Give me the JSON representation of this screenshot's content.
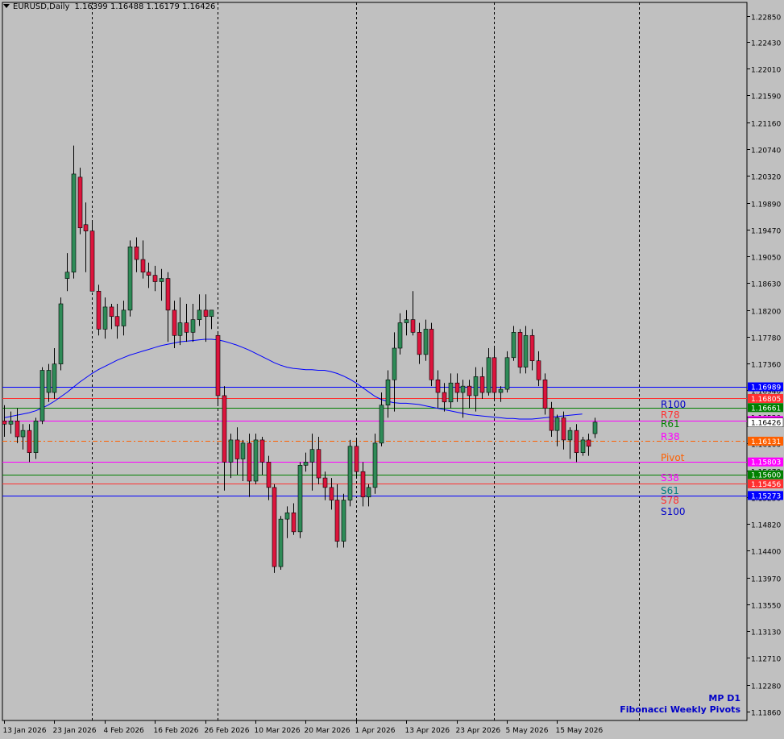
{
  "header": {
    "symbol": "EURUSD,Daily",
    "ohlc": "1.16399 1.16488 1.16179 1.16426"
  },
  "footer": {
    "line1": "MP D1",
    "line2": "Fibonacci Weekly Pivots"
  },
  "colors": {
    "background": "#c0c0c0",
    "bull": "#2e8b57",
    "bear": "#dc143c",
    "ma": "#0000ff",
    "grid": "#000000"
  },
  "chart_data": {
    "type": "candlestick",
    "symbol": "EURUSD",
    "timeframe": "Daily",
    "ylim": [
      1.1172,
      1.2306
    ],
    "y_ticks": [
      "1.22850",
      "1.22430",
      "1.22010",
      "1.21590",
      "1.21160",
      "1.20740",
      "1.20320",
      "1.19890",
      "1.19470",
      "1.19050",
      "1.18630",
      "1.18200",
      "1.17780",
      "1.17360",
      "1.16940",
      "1.16520",
      "1.16100",
      "1.15670",
      "1.15250",
      "1.14820",
      "1.14400",
      "1.13970",
      "1.13550",
      "1.13130",
      "1.12710",
      "1.12280",
      "1.11860"
    ],
    "x_ticks": [
      "13 Jan 2026",
      "23 Jan 2026",
      "4 Feb 2026",
      "16 Feb 2026",
      "26 Feb 2026",
      "10 Mar 2026",
      "20 Mar 2026",
      "1 Apr 2026",
      "13 Apr 2026",
      "23 Apr 2026",
      "5 May 2026",
      "15 May 2026"
    ],
    "x_tick_index": [
      0,
      8,
      16,
      24,
      32,
      40,
      48,
      56,
      64,
      72,
      80,
      88
    ],
    "separator_index": [
      14,
      34,
      56,
      78,
      101
    ],
    "candles": [
      [
        1.1645,
        1.167,
        1.162,
        1.164
      ],
      [
        1.164,
        1.166,
        1.1625,
        1.1645
      ],
      [
        1.1645,
        1.1665,
        1.161,
        1.162
      ],
      [
        1.162,
        1.164,
        1.16,
        1.163
      ],
      [
        1.163,
        1.164,
        1.158,
        1.1595
      ],
      [
        1.1595,
        1.165,
        1.1585,
        1.1645
      ],
      [
        1.1645,
        1.173,
        1.164,
        1.1725
      ],
      [
        1.169,
        1.1735,
        1.1675,
        1.1725
      ],
      [
        1.169,
        1.176,
        1.168,
        1.1735
      ],
      [
        1.1735,
        1.184,
        1.1725,
        1.183
      ],
      [
        1.187,
        1.191,
        1.185,
        1.188
      ],
      [
        1.188,
        1.208,
        1.187,
        1.2035
      ],
      [
        1.203,
        1.2045,
        1.194,
        1.195
      ],
      [
        1.1955,
        1.199,
        1.188,
        1.1945
      ],
      [
        1.1945,
        1.196,
        1.1855,
        1.185
      ],
      [
        1.185,
        1.186,
        1.178,
        1.179
      ],
      [
        1.179,
        1.184,
        1.1775,
        1.1825
      ],
      [
        1.1825,
        1.183,
        1.179,
        1.181
      ],
      [
        1.181,
        1.183,
        1.1775,
        1.1795
      ],
      [
        1.1795,
        1.1835,
        1.178,
        1.182
      ],
      [
        1.182,
        1.193,
        1.181,
        1.192
      ],
      [
        1.192,
        1.1935,
        1.188,
        1.19
      ],
      [
        1.19,
        1.193,
        1.187,
        1.188
      ],
      [
        1.188,
        1.1895,
        1.1855,
        1.1875
      ],
      [
        1.1875,
        1.189,
        1.185,
        1.1865
      ],
      [
        1.1865,
        1.1885,
        1.1835,
        1.187
      ],
      [
        1.187,
        1.188,
        1.177,
        1.182
      ],
      [
        1.182,
        1.1835,
        1.176,
        1.178
      ],
      [
        1.178,
        1.184,
        1.1765,
        1.18
      ],
      [
        1.18,
        1.183,
        1.177,
        1.1785
      ],
      [
        1.1785,
        1.183,
        1.177,
        1.1805
      ],
      [
        1.1805,
        1.1845,
        1.1795,
        1.182
      ],
      [
        1.182,
        1.1845,
        1.177,
        1.181
      ],
      [
        1.181,
        1.182,
        1.179,
        1.182
      ],
      [
        1.178,
        1.1785,
        1.167,
        1.1685
      ],
      [
        1.1685,
        1.17,
        1.1535,
        1.158
      ],
      [
        1.158,
        1.1625,
        1.1555,
        1.1615
      ],
      [
        1.1615,
        1.1635,
        1.156,
        1.1585
      ],
      [
        1.1585,
        1.1615,
        1.155,
        1.161
      ],
      [
        1.161,
        1.1625,
        1.1525,
        1.155
      ],
      [
        1.155,
        1.1625,
        1.1545,
        1.1615
      ],
      [
        1.1615,
        1.162,
        1.156,
        1.158
      ],
      [
        1.158,
        1.159,
        1.152,
        1.154
      ],
      [
        1.154,
        1.1545,
        1.1405,
        1.1415
      ],
      [
        1.1415,
        1.1495,
        1.141,
        1.149
      ],
      [
        1.149,
        1.151,
        1.146,
        1.15
      ],
      [
        1.15,
        1.1515,
        1.1465,
        1.147
      ],
      [
        1.147,
        1.158,
        1.146,
        1.1575
      ],
      [
        1.1575,
        1.1595,
        1.1565,
        1.158
      ],
      [
        1.158,
        1.1625,
        1.1535,
        1.16
      ],
      [
        1.16,
        1.162,
        1.1545,
        1.1555
      ],
      [
        1.1555,
        1.1565,
        1.152,
        1.154
      ],
      [
        1.154,
        1.1555,
        1.1505,
        1.152
      ],
      [
        1.152,
        1.1545,
        1.1445,
        1.1455
      ],
      [
        1.1455,
        1.153,
        1.1445,
        1.152
      ],
      [
        1.152,
        1.1615,
        1.151,
        1.1605
      ],
      [
        1.1605,
        1.1615,
        1.1555,
        1.1565
      ],
      [
        1.1565,
        1.158,
        1.151,
        1.1525
      ],
      [
        1.1525,
        1.1545,
        1.151,
        1.154
      ],
      [
        1.154,
        1.1625,
        1.153,
        1.161
      ],
      [
        1.161,
        1.169,
        1.1605,
        1.167
      ],
      [
        1.167,
        1.1725,
        1.165,
        1.171
      ],
      [
        1.171,
        1.1785,
        1.166,
        1.176
      ],
      [
        1.176,
        1.1815,
        1.175,
        1.18
      ],
      [
        1.18,
        1.182,
        1.178,
        1.1805
      ],
      [
        1.1805,
        1.185,
        1.178,
        1.1785
      ],
      [
        1.1785,
        1.18,
        1.1735,
        1.175
      ],
      [
        1.175,
        1.1805,
        1.174,
        1.179
      ],
      [
        1.179,
        1.18,
        1.17,
        1.171
      ],
      [
        1.171,
        1.1725,
        1.1665,
        1.169
      ],
      [
        1.169,
        1.1705,
        1.166,
        1.1675
      ],
      [
        1.1675,
        1.172,
        1.1665,
        1.1705
      ],
      [
        1.1705,
        1.172,
        1.1675,
        1.169
      ],
      [
        1.169,
        1.171,
        1.165,
        1.17
      ],
      [
        1.17,
        1.171,
        1.1665,
        1.1685
      ],
      [
        1.1685,
        1.173,
        1.166,
        1.1715
      ],
      [
        1.1715,
        1.173,
        1.168,
        1.169
      ],
      [
        1.169,
        1.176,
        1.1685,
        1.1745
      ],
      [
        1.1745,
        1.176,
        1.168,
        1.169
      ],
      [
        1.169,
        1.17,
        1.1675,
        1.1695
      ],
      [
        1.1695,
        1.1755,
        1.169,
        1.1745
      ],
      [
        1.1745,
        1.1795,
        1.174,
        1.1785
      ],
      [
        1.1785,
        1.179,
        1.172,
        1.173
      ],
      [
        1.173,
        1.1795,
        1.172,
        1.178
      ],
      [
        1.178,
        1.179,
        1.1725,
        1.174
      ],
      [
        1.174,
        1.1755,
        1.17,
        1.171
      ],
      [
        1.171,
        1.172,
        1.1655,
        1.1665
      ],
      [
        1.1665,
        1.1675,
        1.162,
        1.163
      ],
      [
        1.163,
        1.1655,
        1.1605,
        1.165
      ],
      [
        1.165,
        1.166,
        1.16,
        1.1615
      ],
      [
        1.1615,
        1.1635,
        1.1585,
        1.163
      ],
      [
        1.163,
        1.164,
        1.158,
        1.1595
      ],
      [
        1.1595,
        1.162,
        1.159,
        1.1615
      ],
      [
        1.1615,
        1.1625,
        1.159,
        1.1605
      ],
      [
        1.1625,
        1.165,
        1.1618,
        1.1643
      ]
    ],
    "ma_series": [
      1.165,
      1.1652,
      1.1654,
      1.1656,
      1.1658,
      1.1661,
      1.1665,
      1.167,
      1.1676,
      1.1683,
      1.169,
      1.1698,
      1.1706,
      1.1713,
      1.172,
      1.1726,
      1.1731,
      1.1736,
      1.1741,
      1.1745,
      1.1749,
      1.1752,
      1.1755,
      1.1758,
      1.1761,
      1.1764,
      1.1766,
      1.1768,
      1.177,
      1.1771,
      1.1772,
      1.1773,
      1.1774,
      1.1774,
      1.1773,
      1.1771,
      1.1768,
      1.1765,
      1.1761,
      1.1757,
      1.1752,
      1.1747,
      1.1742,
      1.1737,
      1.1733,
      1.173,
      1.1728,
      1.1727,
      1.1726,
      1.1726,
      1.1725,
      1.1725,
      1.1723,
      1.172,
      1.1716,
      1.1711,
      1.1705,
      1.1698,
      1.1691,
      1.1684,
      1.1679,
      1.1676,
      1.1674,
      1.1673,
      1.1673,
      1.1672,
      1.1671,
      1.1669,
      1.1667,
      1.1665,
      1.1663,
      1.1661,
      1.1659,
      1.1657,
      1.1655,
      1.1654,
      1.1653,
      1.1652,
      1.1651,
      1.165,
      1.1649,
      1.1649,
      1.1648,
      1.1648,
      1.1648,
      1.1649,
      1.165,
      1.1651,
      1.1652,
      1.1653,
      1.1654,
      1.1655,
      1.1656
    ],
    "pivot_levels": [
      {
        "name": "R100",
        "value": 1.16989,
        "label": "1.16989",
        "color": "#0000ff",
        "style": "solid"
      },
      {
        "name": "R78",
        "value": 1.16805,
        "label": "1.16805",
        "color": "#ff3030",
        "style": "solid"
      },
      {
        "name": "R61",
        "value": 1.16661,
        "label": "1.16661",
        "color": "#008000",
        "style": "solid"
      },
      {
        "name": "R38",
        "value": 1.16458,
        "label": "1.16458",
        "color": "#ff00ff",
        "style": "solid"
      },
      {
        "name": "Pivot",
        "value": 1.16131,
        "label": "1.16131",
        "color": "#ff6000",
        "style": "dashdot"
      },
      {
        "name": "S38",
        "value": 1.15803,
        "label": "1.15803",
        "color": "#ff00ff",
        "style": "solid"
      },
      {
        "name": "S61",
        "value": 1.156,
        "label": "1.15600",
        "color": "#008000",
        "style": "solid"
      },
      {
        "name": "S78",
        "value": 1.15456,
        "label": "1.15456",
        "color": "#ff3030",
        "style": "solid"
      },
      {
        "name": "S100",
        "value": 1.15273,
        "label": "1.15273",
        "color": "#0000ff",
        "style": "solid"
      }
    ],
    "level_name_colors": {
      "R100": "#0000c8",
      "R78": "#ff3030",
      "R61": "#008000",
      "R38": "#ff00ff",
      "Pivot": "#ff6000",
      "S38": "#ff00ff",
      "S61": "#008080",
      "S78": "#ff3030",
      "S100": "#0000c8"
    },
    "current_price": {
      "value": 1.16426,
      "label": "1.16426"
    }
  }
}
